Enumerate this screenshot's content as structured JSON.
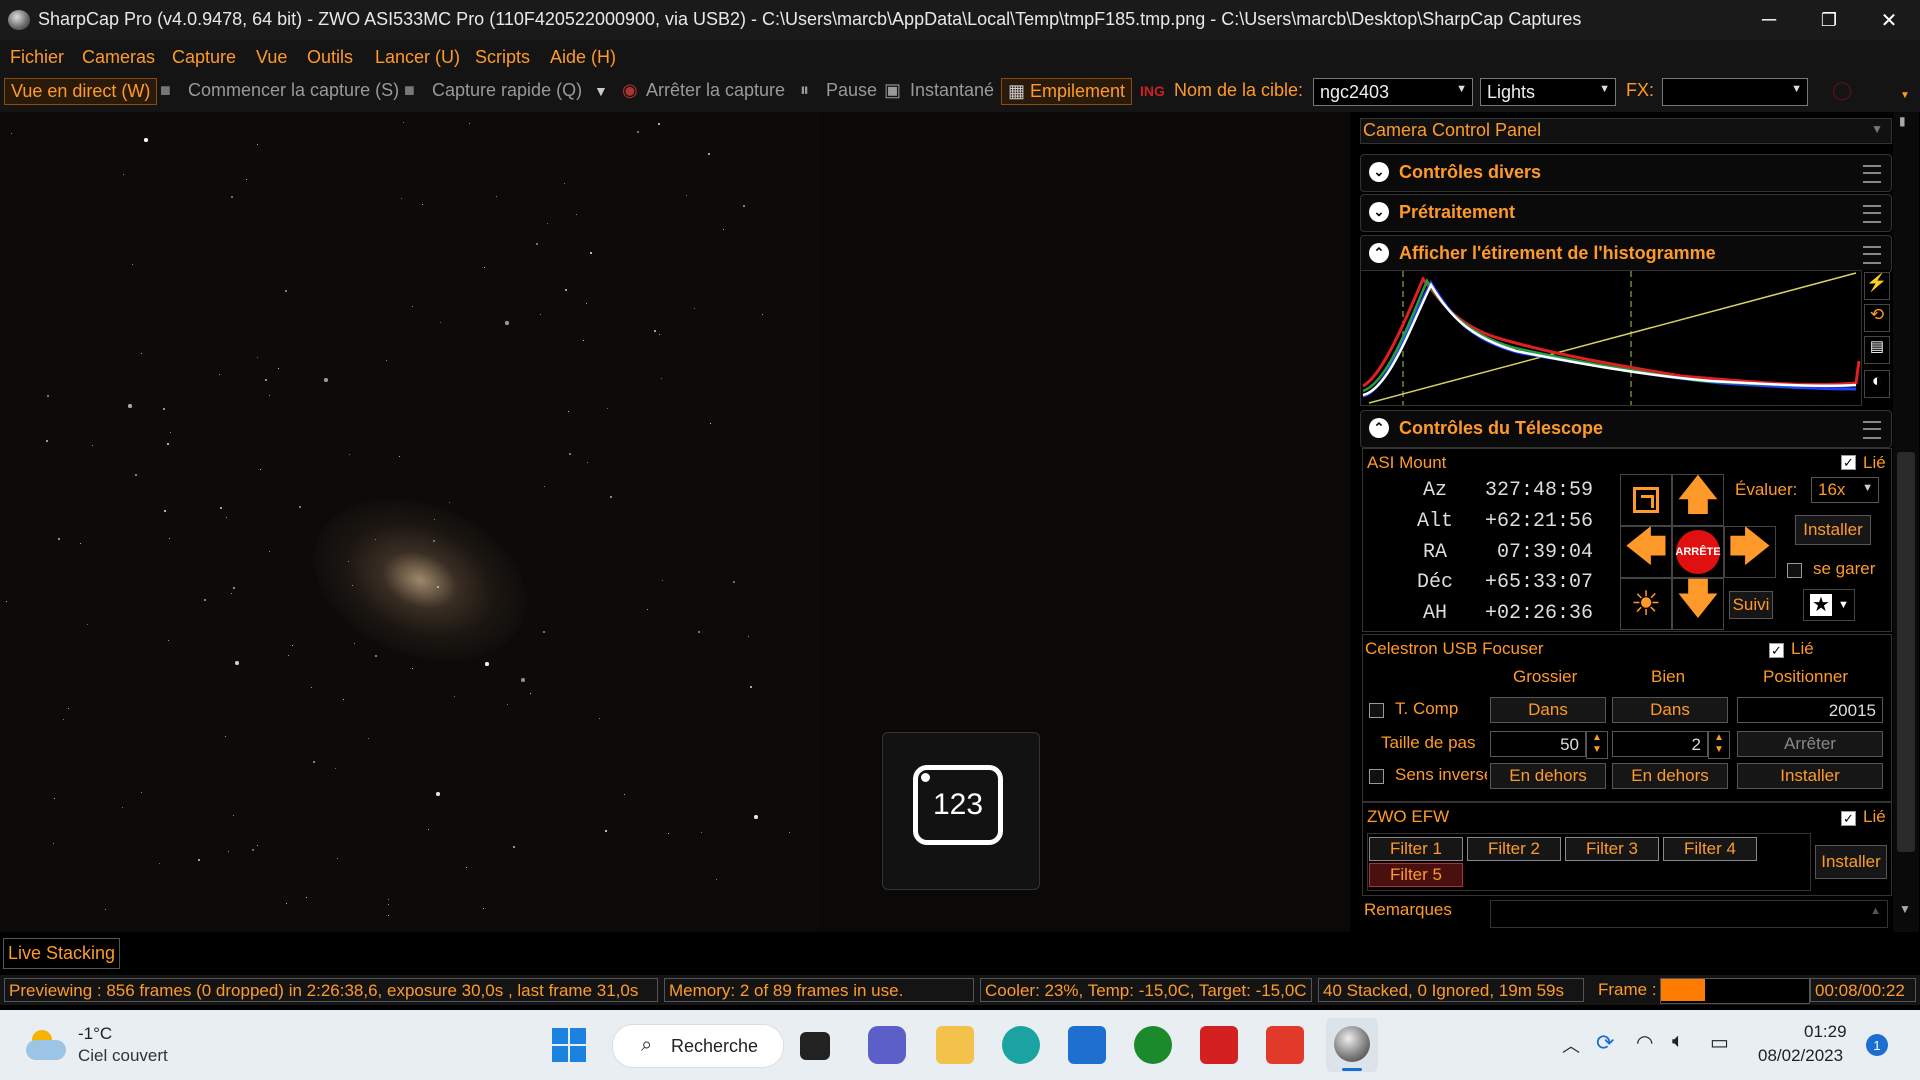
{
  "window": {
    "title": "SharpCap Pro (v4.0.9478, 64 bit) - ZWO ASI533MC Pro (110F420522000900, via USB2) - C:\\Users\\marcb\\AppData\\Local\\Temp\\tmpF185.tmp.png - C:\\Users\\marcb\\Desktop\\SharpCap Captures",
    "minimize": "─",
    "restore": "❐",
    "close": "✕"
  },
  "menu": [
    "Fichier",
    "Cameras",
    "Capture",
    "Vue",
    "Outils",
    "Lancer (U)",
    "Scripts",
    "Aide (H)"
  ],
  "toolbar": {
    "live_view": "Vue en direct (W)",
    "start_capture": "Commencer la capture (S)",
    "quick_capture": "Capture rapide (Q)",
    "stop_capture": "Arrêter la capture",
    "pause": "Pause",
    "snapshot": "Instantané",
    "stacking": "Empilement",
    "target_label": "Nom de la cible:",
    "target_value": "ngc2403",
    "frame_type": "Lights",
    "fx_label": "FX:"
  },
  "overlay": {
    "badge_text": "123"
  },
  "live_stacking_tab": "Live Stacking",
  "panel": {
    "title": "Camera Control Panel",
    "sections": {
      "misc": "Contrôles divers",
      "preprocessing": "Prétraitement",
      "histogram": "Afficher l'étirement de l'histogramme",
      "telescope": "Contrôles du Télescope"
    },
    "mount": {
      "name": "ASI Mount",
      "linked": "Lié",
      "rows": [
        {
          "label": "Az",
          "value": "327:48:59"
        },
        {
          "label": "Alt",
          "value": "+62:21:56"
        },
        {
          "label": "RA",
          "value": "07:39:04"
        },
        {
          "label": "Déc",
          "value": "+65:33:07"
        },
        {
          "label": "AH",
          "value": "+02:26:36"
        }
      ],
      "stop": "ARRÊTE",
      "rate_label": "Évaluer:",
      "rate_value": "16x",
      "install": "Installer",
      "park": "se garer",
      "tracking": "Suivi"
    },
    "focuser": {
      "name": "Celestron USB Focuser",
      "linked": "Lié",
      "col_coarse": "Grossier",
      "col_fine": "Bien",
      "col_position": "Positionner",
      "tcomp": "T. Comp",
      "in_coarse": "Dans",
      "in_fine": "Dans",
      "position": "20015",
      "step_label": "Taille de pas",
      "step_coarse": "50",
      "step_fine": "2",
      "stop": "Arrêter",
      "reverse": "Sens inversé",
      "out_coarse": "En dehors",
      "out_fine": "En dehors",
      "install": "Installer"
    },
    "efw": {
      "name": "ZWO EFW",
      "linked": "Lié",
      "filters": [
        "Filter 1",
        "Filter 2",
        "Filter 3",
        "Filter 4",
        "Filter 5"
      ],
      "install": "Installer"
    },
    "notes": "Remarques"
  },
  "status": {
    "preview": "Previewing : 856 frames (0 dropped) in 2:26:38,6, exposure 30,0s , last frame 31,0s",
    "memory": "Memory: 2 of 89 frames in use.",
    "cooler": "Cooler: 23%, Temp: -15,0C, Target: -15,0C",
    "stacked": "40 Stacked, 0 Ignored, 19m 59s",
    "frame_label": "Frame :",
    "frame_progress": 0.3,
    "frame_time": "00:08/00:22"
  },
  "taskbar": {
    "weather_temp": "-1°C",
    "weather_desc": "Ciel couvert",
    "search": "Recherche",
    "time": "01:29",
    "date": "08/02/2023",
    "notif_count": "1"
  }
}
